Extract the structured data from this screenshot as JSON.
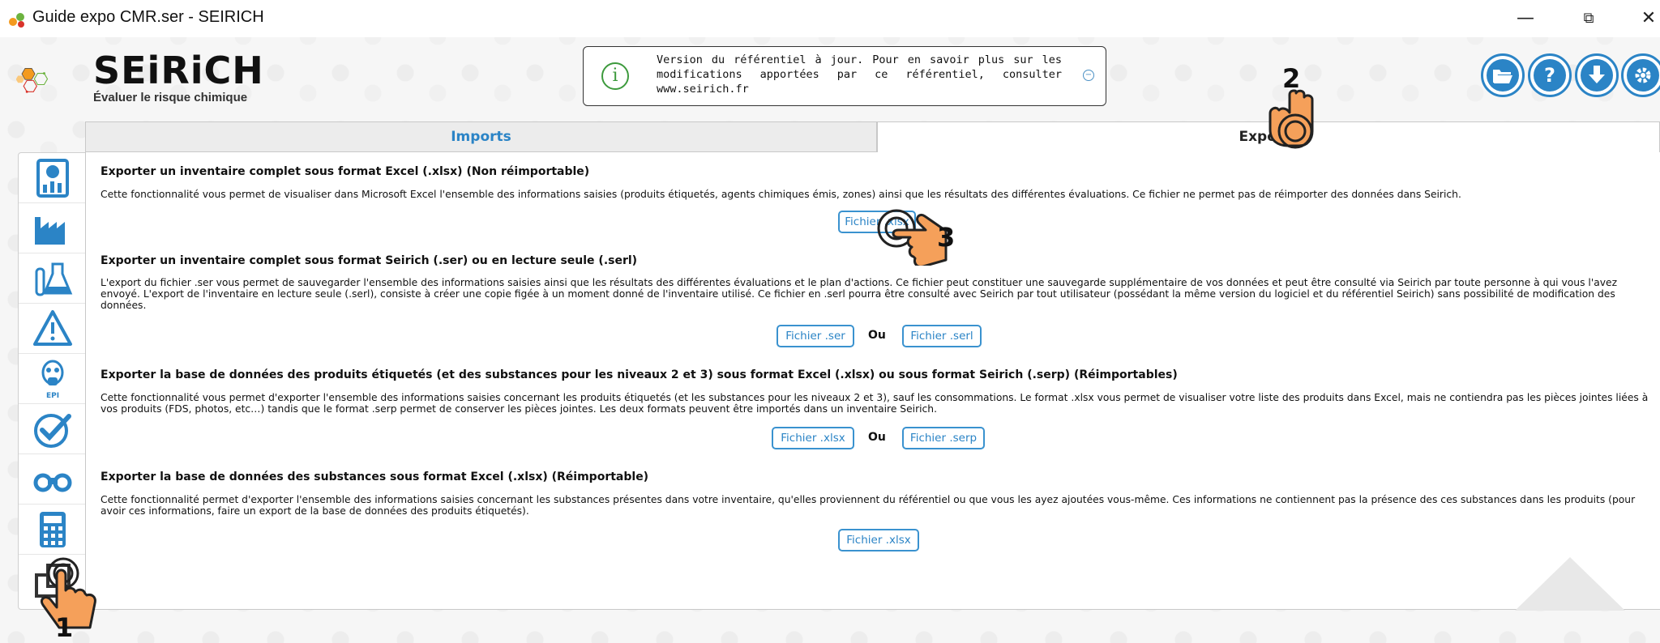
{
  "window": {
    "title": "Guide expo CMR.ser - SEIRICH",
    "min_glyph": "—",
    "max_glyph": "⧉",
    "close_glyph": "✕"
  },
  "logo": {
    "word": "SEiRiCH",
    "tagline": "Évaluer le risque chimique"
  },
  "info": {
    "text": "Version du référentiel à jour. Pour en savoir plus sur les modifications apportées par ce référentiel, consulter www.seirich.fr",
    "icon": "info-icon"
  },
  "toolbar": {
    "buttons": [
      "folder-open-icon",
      "help-icon",
      "download-icon",
      "settings-icon"
    ],
    "help_glyph": "?"
  },
  "sidebar": {
    "items": [
      "dashboard-icon",
      "factory-icon",
      "lab-flask-icon",
      "warning-icon",
      "respirator-epi-icon",
      "check-icon",
      "binoculars-icon",
      "calculator-icon",
      "export-icon"
    ],
    "epi_label": "EPI"
  },
  "tabs": {
    "imports": "Imports",
    "exports": "Exports"
  },
  "sections": [
    {
      "title": "Exporter un inventaire complet sous format Excel (.xlsx) (Non réimportable)",
      "desc": "Cette fonctionnalité vous permet de visualiser dans Microsoft Excel l'ensemble des informations saisies (produits étiquetés, agents chimiques émis, zones) ainsi que les résultats des différentes évaluations. Ce fichier ne permet pas de réimporter des données dans Seirich.",
      "button": "Fichier .xlsx"
    },
    {
      "title": "Exporter un inventaire complet sous format Seirich (.ser) ou en lecture seule (.serl)",
      "desc": "L'export du fichier .ser vous permet de sauvegarder l'ensemble des informations saisies ainsi que les résultats des différentes évaluations et le plan d'actions. Ce fichier peut constituer une sauvegarde supplémentaire de vos données et peut être consulté via Seirich par toute personne à qui vous l'avez envoyé. L'export de l'inventaire en lecture seule (.serl), consiste à créer une copie figée à un moment donné de l'inventaire utilisé. Ce fichier en .serl pourra être consulté avec Seirich par tout utilisateur (possédant la même version du logiciel et du référentiel Seirich) sans possibilité de modification des données.",
      "button_a": "Fichier .ser",
      "sep": "Ou",
      "button_b": "Fichier .serl"
    },
    {
      "title": "Exporter la base de données des produits étiquetés (et des substances pour les niveaux 2 et 3) sous format Excel (.xlsx) ou sous format Seirich (.serp) (Réimportables)",
      "desc": "Cette fonctionnalité vous permet d'exporter l'ensemble des informations saisies concernant les produits étiquetés (et les substances pour les niveaux 2 et 3), sauf les consommations. Le format .xlsx vous permet de visualiser votre liste des produits dans Excel, mais ne contiendra pas les pièces jointes liées à vos produits (FDS, photos, etc…) tandis que le format .serp permet de conserver les pièces jointes. Les deux formats peuvent être importés dans un inventaire Seirich.",
      "button_a": "Fichier .xlsx",
      "sep": "Ou",
      "button_b": "Fichier .serp"
    },
    {
      "title": "Exporter la base de données des substances sous format Excel (.xlsx) (Réimportable)",
      "desc": "Cette fonctionnalité permet d'exporter l'ensemble des informations saisies concernant les substances présentes dans votre inventaire, qu'elles proviennent du référentiel ou que vous les ayez ajoutées vous-même. Ces informations ne contiennent pas la présence des ces substances dans les produits (pour avoir ces informations, faire un export de la base de données des produits étiquetés).",
      "button": "Fichier .xlsx"
    }
  ],
  "annotations": [
    "1",
    "2",
    "3"
  ],
  "colors": {
    "accent": "#2b84c6",
    "logo_orange": "#f39a1e",
    "logo_green": "#6cb33f",
    "logo_red": "#d9342b",
    "hand": "#f5a05a"
  }
}
